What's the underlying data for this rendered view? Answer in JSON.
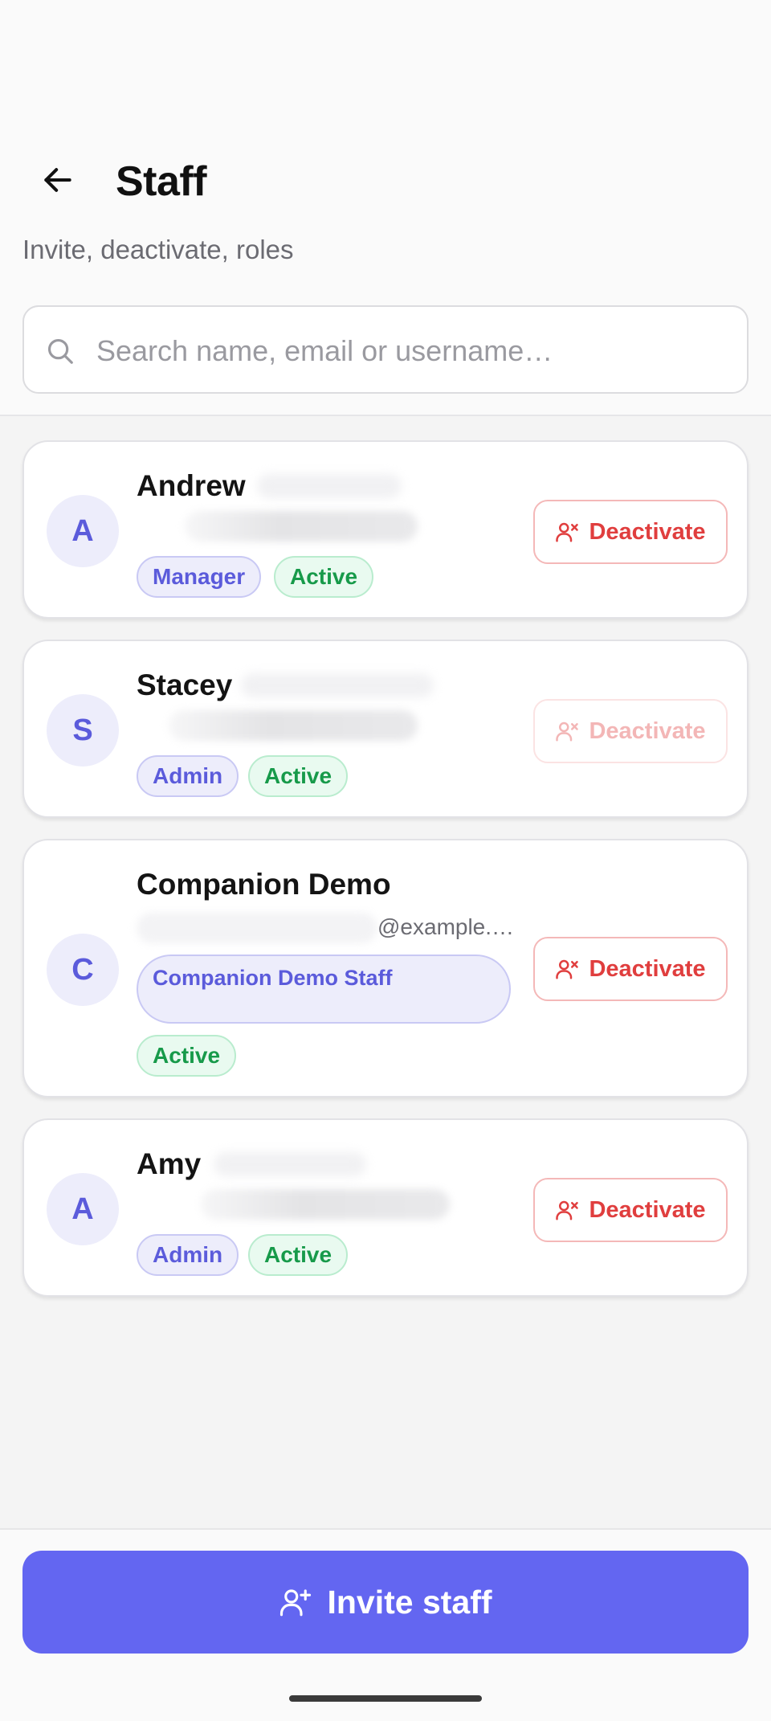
{
  "header": {
    "title": "Staff",
    "subtitle": "Invite, deactivate, roles"
  },
  "search": {
    "placeholder": "Search name, email or username…",
    "value": ""
  },
  "staff": [
    {
      "initial": "A",
      "name": "Andrew",
      "email_visible": "",
      "role": "Manager",
      "status": "Active",
      "action": "Deactivate",
      "action_enabled": true
    },
    {
      "initial": "S",
      "name": "Stacey",
      "email_visible": "",
      "role": "Admin",
      "status": "Active",
      "action": "Deactivate",
      "action_enabled": false
    },
    {
      "initial": "C",
      "name": "Companion Demo",
      "email_visible": "@example.…",
      "role": "Companion Demo Staff",
      "status": "Active",
      "action": "Deactivate",
      "action_enabled": true
    },
    {
      "initial": "A",
      "name": "Amy",
      "email_visible": "",
      "role": "Admin",
      "status": "Active",
      "action": "Deactivate",
      "action_enabled": true
    }
  ],
  "footer": {
    "invite_label": "Invite staff"
  },
  "colors": {
    "accent": "#6366f1",
    "role_badge": "#5b5bdb",
    "active_badge": "#179a4a",
    "danger": "#e03e3e"
  },
  "icons": {
    "back": "arrow-left-icon",
    "search": "search-icon",
    "deactivate": "user-x-icon",
    "invite": "user-plus-icon"
  }
}
